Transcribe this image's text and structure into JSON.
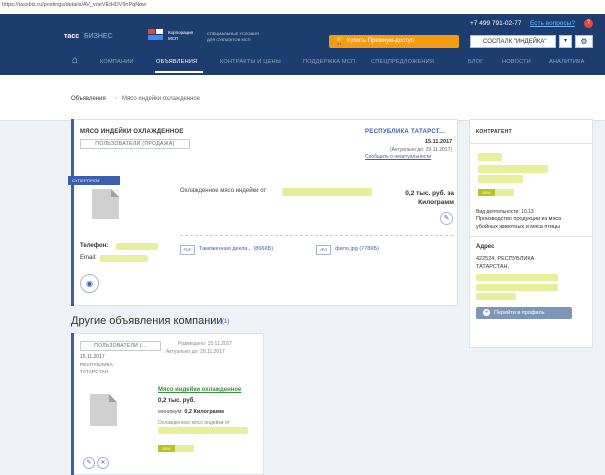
{
  "url": "https://tassbiz.ru/postings/details/AV_voeVEtHDV9nPqNow",
  "header": {
    "logo_tass": "тасс",
    "logo_biz": "БИЗНЕС",
    "corp_line1": "Корпорация",
    "corp_line2": "МСП",
    "spec_line1": "СПЕЦИАЛЬНЫЕ УСЛОВИЯ",
    "spec_line2": "ДЛЯ СУБЪЕКТОВ МСП",
    "phone": "+7 499 791-02-77",
    "questions": "Есть вопросы?",
    "questions_icon": "?",
    "premium_label": "Купить Премиум-доступ",
    "premium_icon": "trophy-icon",
    "search_value": "СОСПАЛК \"ИНДЕЙКА\"",
    "dropdown_glyph": "▾",
    "gear_glyph": "⚙",
    "home_glyph": "⌂"
  },
  "nav": [
    {
      "label": "КОМПАНИИ"
    },
    {
      "label": "ОБЪЯВЛЕНИЯ"
    },
    {
      "label": "КОНТРАКТЫ И ЦЕНЫ"
    },
    {
      "label": "ПОДДЕРЖКА МСП"
    },
    {
      "label": "СПЕЦПРЕДЛОЖЕНИЯ"
    },
    {
      "label": "БЛОГ"
    },
    {
      "label": "НОВОСТИ"
    },
    {
      "label": "АНАЛИТИКА"
    }
  ],
  "breadcrumb": {
    "root": "Объявления",
    "separator": "•",
    "current": "Мясо индейки охлажденное"
  },
  "posting": {
    "title": "МЯСО ИНДЕЙКИ ОХЛАЖДЕННОЕ",
    "user_type": "ПОЛЬЗОВАТЕЛИ (ПРОДАЖА)",
    "region": "РЕСПУБЛИКА ТАТАРСТ...",
    "date": "15.11.2017",
    "actual": "(Актуально до: 29.11.2017)",
    "report": "Сообщить о неактуальности",
    "badge": "СУПЕРПРЕМ",
    "description": "Охлажденное мясо индейки от",
    "price_line1": "0,2 тыс. руб. за",
    "price_line2": "Килограмм",
    "phone_label": "Телефон:",
    "email_label": "Email:",
    "file1_type": "PDF",
    "file1_name": "Таможенная декла... (866КБ)",
    "file2_type": "JPG",
    "file2_name": "фило.jpg (778КБ)",
    "edit_glyph": "✎",
    "eye_glyph": "◉"
  },
  "contractor": {
    "title": "КОНТРАГЕНТ",
    "rating": "80%",
    "activity": "Вид деятельности: 10.13",
    "product_line1": "Производство продукции из мяса",
    "product_line2": "убойных животных и мяса птицы",
    "address_label": "Адрес",
    "address_line1": "422524, РЕСПУБЛИКА",
    "address_line2": "ТАТАРСТАН,",
    "profile_button": "Перейти в профиль",
    "profile_glyph": "●"
  },
  "other": {
    "title": "Другие объявления компании",
    "count": "(1)",
    "card": {
      "user_type": "ПОЛЬЗОВАТЕЛИ (...",
      "date": "15.11.2017",
      "region1": "РЕСПУБЛИКА",
      "region2": "ТАТАРСТАН",
      "placed": "Размещено: 15.11.2017",
      "actual": "Актуально до: 29.11.2017",
      "link": "Мясо индейки охлажденное",
      "price": "0,2 тыс. руб.",
      "min_label": "минимум:",
      "min_value": "0,2 Килограмм",
      "desc": "Охлажденное мясо индейки от",
      "rating": "80%",
      "edit_glyph": "✎",
      "delete_glyph": "✕"
    }
  }
}
